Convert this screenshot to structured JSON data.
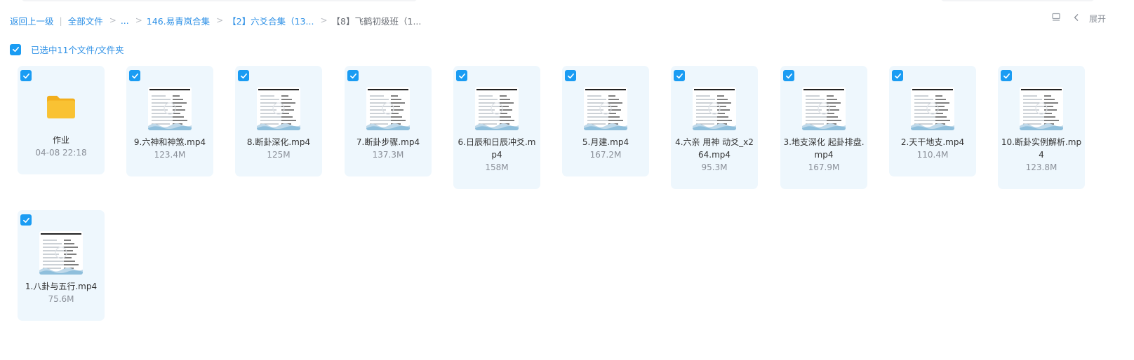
{
  "breadcrumb": {
    "back": "返回上一级",
    "sep": "|",
    "items": [
      "全部文件",
      "...",
      "146.易青岚合集",
      "【2】六爻合集（13...",
      "【8】飞鹤初级班（1..."
    ]
  },
  "toolbar": {
    "expand_label": "展开",
    "view_icon": "list-view-icon",
    "collapse_icon": "chevron-left-icon"
  },
  "selection": {
    "label": "已选中11个文件/文件夹",
    "checked": true
  },
  "colors": {
    "accent": "#1a9cf3",
    "link": "#2b8fe6",
    "card_bg": "#eef7fd",
    "folder": "#f9c233"
  },
  "files": [
    {
      "name": "作业",
      "meta": "04-08 22:18",
      "kind": "folder",
      "icon": "folder-icon"
    },
    {
      "name": "9.六神和神煞.mp4",
      "meta": "123.4M",
      "kind": "video"
    },
    {
      "name": "8.断卦深化.mp4",
      "meta": "125M",
      "kind": "video"
    },
    {
      "name": "7.断卦步骤.mp4",
      "meta": "137.3M",
      "kind": "video"
    },
    {
      "name": "6.日辰和日辰冲爻.mp4",
      "meta": "158M",
      "kind": "video"
    },
    {
      "name": "5.月建.mp4",
      "meta": "167.2M",
      "kind": "video"
    },
    {
      "name": "4.六亲 用神 动爻_x264.mp4",
      "meta": "95.3M",
      "kind": "video"
    },
    {
      "name": "3.地支深化 起卦排盘.mp4",
      "meta": "167.9M",
      "kind": "video"
    },
    {
      "name": "2.天干地支.mp4",
      "meta": "110.4M",
      "kind": "video"
    },
    {
      "name": "10.断卦实例解析.mp4",
      "meta": "123.8M",
      "kind": "video"
    },
    {
      "name": "1.八卦与五行.mp4",
      "meta": "75.6M",
      "kind": "video"
    }
  ]
}
